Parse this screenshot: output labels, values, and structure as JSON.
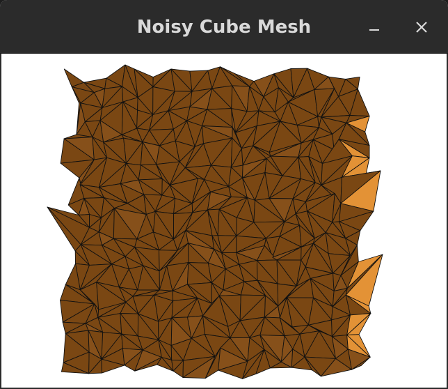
{
  "window": {
    "title": "Noisy Cube Mesh"
  },
  "titlebar": {
    "minimize_icon": "minimize-icon",
    "close_icon": "close-icon"
  },
  "colors": {
    "titlebar_bg": "#2b2b2b",
    "title_text": "#d9d9d9",
    "mesh_face": "#7a4713",
    "mesh_highlight": "#e39236",
    "mesh_edge": "#111111",
    "viewport_bg": "#ffffff"
  }
}
